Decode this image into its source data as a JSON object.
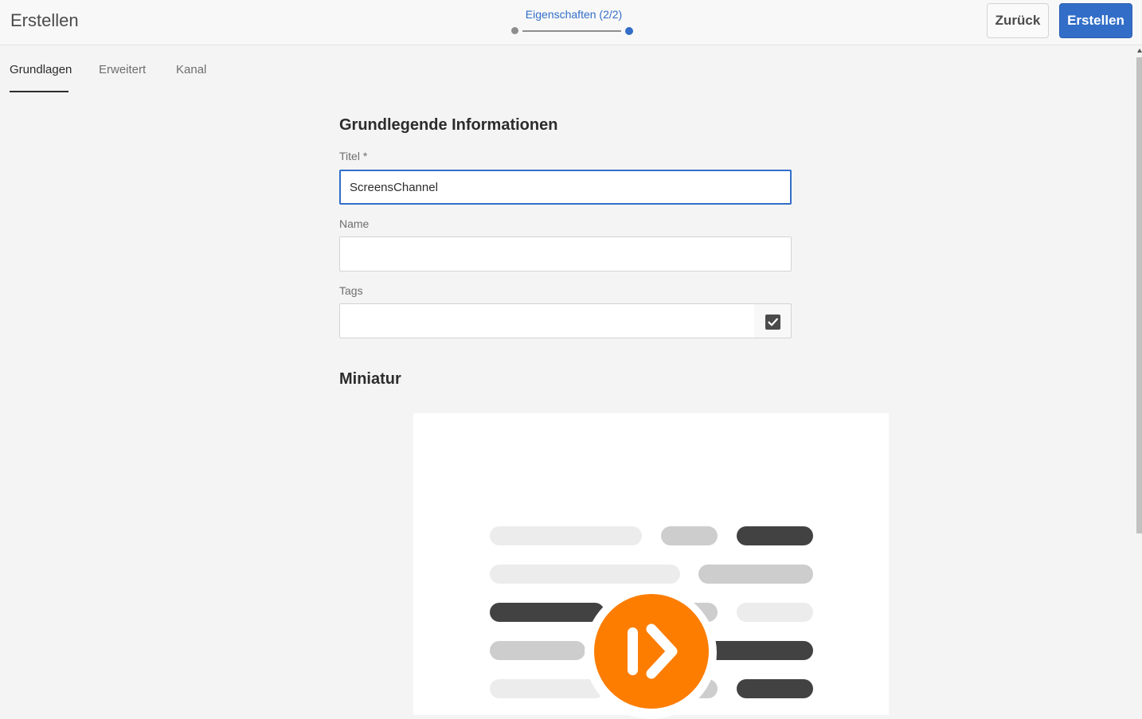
{
  "header": {
    "title": "Erstellen",
    "wizard_step_label": "Eigenschaften (2/2)",
    "back_label": "Zurück",
    "create_label": "Erstellen"
  },
  "tabs": [
    {
      "label": "Grundlagen",
      "active": true
    },
    {
      "label": "Erweitert",
      "active": false
    },
    {
      "label": "Kanal",
      "active": false
    }
  ],
  "form": {
    "section_title": "Grundlegende Informationen",
    "title_label": "Titel *",
    "title_value": "ScreensChannel",
    "name_label": "Name",
    "name_value": "",
    "tags_label": "Tags",
    "tags_value": ""
  },
  "thumbnail": {
    "section_title": "Miniatur"
  },
  "icons": {
    "tags_picker": "checkmark-square-icon",
    "thumbnail_badge": "play-icon"
  },
  "colors": {
    "accent": "#326ec8",
    "badge": "#fd7d00"
  }
}
